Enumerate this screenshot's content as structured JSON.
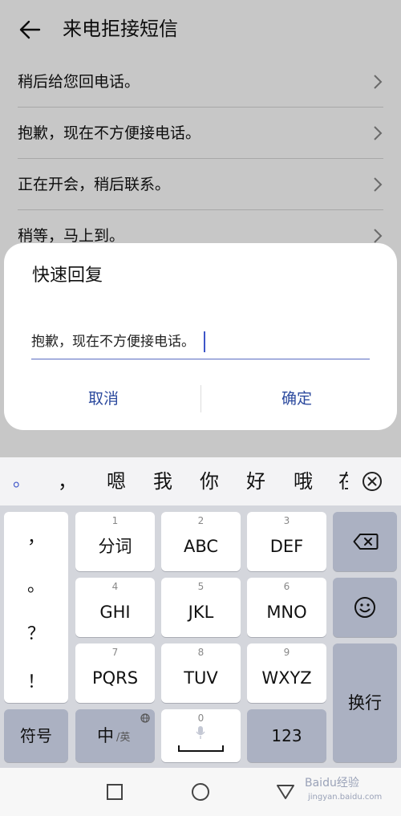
{
  "header": {
    "title": "来电拒接短信"
  },
  "replies": [
    "稍后给您回电话。",
    "抱歉，现在不方便接电话。",
    "正在开会，稍后联系。",
    "稍等，马上到。"
  ],
  "dialog": {
    "title": "快速回复",
    "input_value": "抱歉，现在不方便接电话。",
    "cancel_label": "取消",
    "ok_label": "确定"
  },
  "candidates": [
    "。",
    "，",
    "嗯",
    "我",
    "你",
    "好",
    "哦",
    "在"
  ],
  "keyboard": {
    "punctuation": [
      "，",
      "。",
      "？",
      "！"
    ],
    "keys": [
      {
        "num": "1",
        "label": "分词"
      },
      {
        "num": "2",
        "label": "ABC"
      },
      {
        "num": "3",
        "label": "DEF"
      },
      {
        "num": "4",
        "label": "GHI"
      },
      {
        "num": "5",
        "label": "JKL"
      },
      {
        "num": "6",
        "label": "MNO"
      },
      {
        "num": "7",
        "label": "PQRS"
      },
      {
        "num": "8",
        "label": "TUV"
      },
      {
        "num": "9",
        "label": "WXYZ"
      }
    ],
    "enter_label": "换行",
    "symbols_label": "符号",
    "lang_main": "中",
    "lang_alt": "/英",
    "space_num": "0",
    "num_label": "123"
  },
  "watermark": {
    "main": "Baidu经验",
    "sub": "jingyan.baidu.com"
  },
  "icons": {
    "back": "arrow-left-icon",
    "chevron": "chevron-right-icon",
    "close": "circle-x-icon",
    "backspace": "backspace-icon",
    "emoji": "smiley-icon",
    "globe": "globe-icon",
    "mic": "microphone-icon",
    "nav_recent": "square-icon",
    "nav_home": "circle-icon",
    "nav_back": "triangle-icon"
  },
  "colors": {
    "accent": "#2c4a9e",
    "caret": "#3d55c8",
    "keyboard_bg": "#d4d6dc",
    "dark_key": "#abb1c2"
  }
}
